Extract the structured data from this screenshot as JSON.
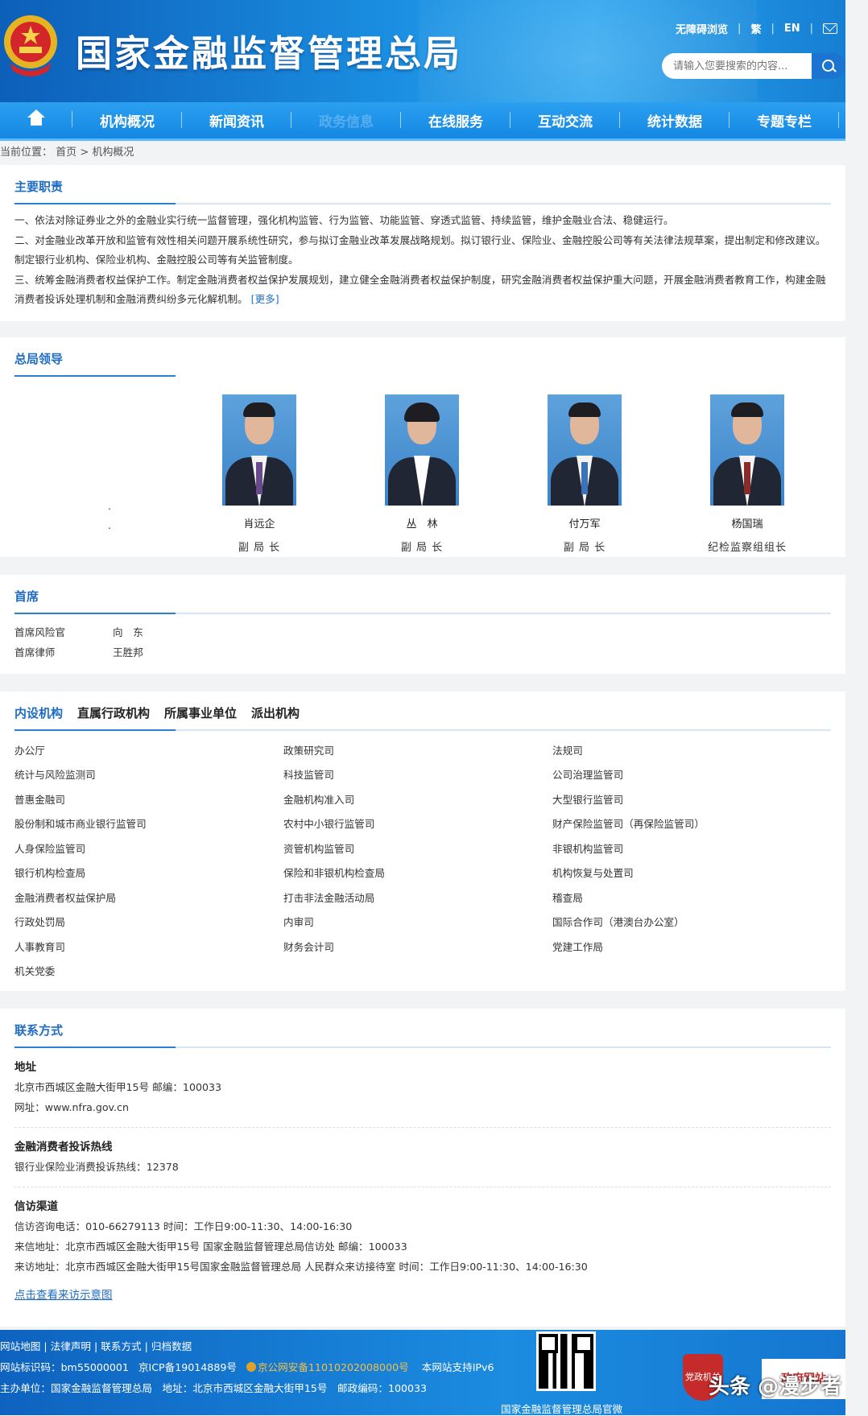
{
  "header": {
    "title": "国家金融监督管理总局",
    "accessible_label": "无障碍浏览",
    "traditional_label": "繁",
    "english_label": "EN",
    "search_placeholder": "请输入您要搜索的内容..."
  },
  "nav": {
    "items": [
      "机构概况",
      "新闻资讯",
      "政务信息",
      "在线服务",
      "互动交流",
      "统计数据",
      "专题专栏"
    ]
  },
  "breadcrumb": {
    "prefix": "当前位置：",
    "home": "首页",
    "sep": " > ",
    "current": "机构概况"
  },
  "duties": {
    "title": "主要职责",
    "items": [
      "一、依法对除证券业之外的金融业实行统一监督管理，强化机构监管、行为监管、功能监管、穿透式监管、持续监管，维护金融业合法、稳健运行。",
      "二、对金融业改革开放和监管有效性相关问题开展系统性研究，参与拟订金融业改革发展战略规划。拟订银行业、保险业、金融控股公司等有关法律法规草案，提出制定和修改建议。制定银行业机构、保险业机构、金融控股公司等有关监管制度。",
      "三、统筹金融消费者权益保护工作。制定金融消费者权益保护发展规划，建立健全金融消费者权益保护制度，研究金融消费者权益保护重大问题，开展金融消费者教育工作，构建金融消费者投诉处理机制和金融消费纠纷多元化解机制。"
    ],
    "more_label": "[更多]"
  },
  "leaders": {
    "title": "总局领导",
    "dot1": ".",
    "dot2": ".",
    "people": [
      {
        "name": "肖远企",
        "role": "副 局 长"
      },
      {
        "name": "丛　林",
        "role": "副 局 长"
      },
      {
        "name": "付万军",
        "role": "副 局 长"
      },
      {
        "name": "杨国瑞",
        "role": "纪检监察组组长"
      }
    ]
  },
  "chiefs": {
    "title": "首席",
    "rows": [
      {
        "role": "首席风险官",
        "name": "向　东"
      },
      {
        "role": "首席律师",
        "name": "王胜邦"
      }
    ]
  },
  "orgs": {
    "tabs": [
      "内设机构",
      "直属行政机构",
      "所属事业单位",
      "派出机构"
    ],
    "items": [
      "办公厅",
      "政策研究司",
      "法规司",
      "统计与风险监测司",
      "科技监管司",
      "公司治理监管司",
      "普惠金融司",
      "金融机构准入司",
      "大型银行监管司",
      "股份制和城市商业银行监管司",
      "农村中小银行监管司",
      "财产保险监管司（再保险监管司）",
      "人身保险监管司",
      "资管机构监管司",
      "非银机构监管司",
      "银行机构检查局",
      "保险和非银机构检查局",
      "机构恢复与处置司",
      "金融消费者权益保护局",
      "打击非法金融活动局",
      "稽查局",
      "行政处罚局",
      "内审司",
      "国际合作司（港澳台办公室）",
      "人事教育司",
      "财务会计司",
      "党建工作局",
      "机关党委"
    ]
  },
  "contact": {
    "title": "联系方式",
    "address_title": "地址",
    "address_line": "北京市西城区金融大街甲15号 邮编：100033",
    "website_line": "网址：www.nfra.gov.cn",
    "hotline_title": "金融消费者投诉热线",
    "hotline_line": "银行业保险业消费投诉热线：12378",
    "petition_title": "信访渠道",
    "petition_lines": [
      "信访咨询电话：010-66279113 时间：工作日9:00-11:30、14:00-16:30",
      "来信地址：北京市西城区金融大街甲15号 国家金融监督管理总局信访处 邮编：100033",
      "来访地址：北京市西城区金融大街甲15号国家金融监督管理总局 人民群众来访接待室 时间：工作日9:00-11:30、14:00-16:30"
    ],
    "map_link": "点击查看来访示意图"
  },
  "footer": {
    "links": [
      "网站地图",
      "法律声明",
      "联系方式",
      "归档数据"
    ],
    "site_id": "网站标识码：bm55000001",
    "icp": "京ICP备19014889号",
    "police": "京公网安备11010202008000号",
    "ipv6": "本网站支持IPv6",
    "host": "主办单位：国家金融监督管理总局　地址：北京市西城区金融大街甲15号　邮政编码：100033",
    "qr_caption": "国家金融监督管理总局官微",
    "badge": "党政机关",
    "watermark": "头条 @漫步者",
    "gov_label": "政府网站"
  }
}
